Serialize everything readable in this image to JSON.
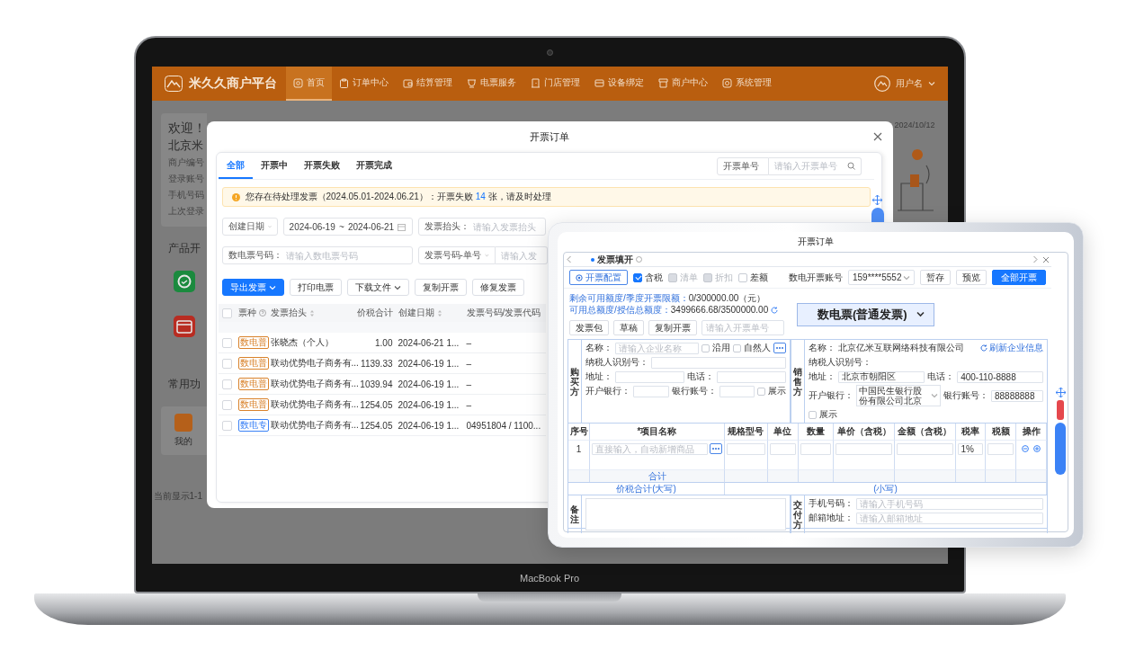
{
  "laptop": {
    "model": "MacBook Pro"
  },
  "nav": {
    "brand": "米久久商户平台",
    "items": [
      {
        "label": "首页",
        "selected": true
      },
      {
        "label": "订单中心",
        "selected": false
      },
      {
        "label": "结算管理",
        "selected": false
      },
      {
        "label": "电票服务",
        "selected": false
      },
      {
        "label": "门店管理",
        "selected": false
      },
      {
        "label": "设备绑定",
        "selected": false
      },
      {
        "label": "商户中心",
        "selected": false
      },
      {
        "label": "系统管理",
        "selected": false
      }
    ],
    "user": "用户名"
  },
  "dashboard": {
    "greeting": "欢迎！",
    "company": "北京米",
    "info_labels": [
      "商户编号",
      "登录账号",
      "手机号码",
      "上次登录"
    ],
    "products_heading": "产品开",
    "common_heading": "常用功",
    "shortcut": "我的",
    "footer": "当前显示1-1",
    "date": "2024/10/12"
  },
  "orders_dialog": {
    "title": "开票订单",
    "tabs": [
      {
        "label": "全部",
        "selected": true
      },
      {
        "label": "开票中",
        "selected": false
      },
      {
        "label": "开票失败",
        "selected": false
      },
      {
        "label": "开票完成",
        "selected": false
      }
    ],
    "search": {
      "field": "开票单号",
      "placeholder": "请输入开票单号"
    },
    "alert": {
      "before": "您存在待处理发票（2024.05.01-2024.06.21）：开票失败 ",
      "count": "14",
      "after": " 张，请及时处理"
    },
    "filters": {
      "date_type": "创建日期",
      "date_from": "2024-06-19",
      "separator": "~",
      "date_to": "2024-06-21",
      "title_label": "发票抬头：",
      "title_placeholder": "请输入发票抬头",
      "number_label": "数电票号码：",
      "number_placeholder": "请输入数电票号码",
      "code_type": "发票号码-单号",
      "code_placeholder": "请输入发"
    },
    "buttons": [
      {
        "label": "导出发票",
        "kind": "primary",
        "dropdown": true
      },
      {
        "label": "打印电票",
        "kind": "default",
        "dropdown": false
      },
      {
        "label": "下载文件",
        "kind": "default",
        "dropdown": true
      },
      {
        "label": "复制开票",
        "kind": "default",
        "dropdown": false
      },
      {
        "label": "修复发票",
        "kind": "default",
        "dropdown": false
      }
    ],
    "header_checked": false,
    "columns": [
      {
        "label": "票种",
        "help": true,
        "sortable": false,
        "kind": "text"
      },
      {
        "label": "发票抬头",
        "help": false,
        "sortable": true,
        "kind": "text"
      },
      {
        "label": "价税合计",
        "help": false,
        "sortable": false,
        "kind": "number"
      },
      {
        "label": "创建日期",
        "help": false,
        "sortable": true,
        "kind": "text"
      },
      {
        "label": "发票号码/发票代码",
        "help": false,
        "sortable": false,
        "kind": "text"
      }
    ],
    "rows": [
      {
        "checked": false,
        "type": "数电普",
        "color": "#d9822b",
        "title": "张晓杰（个人）",
        "amount": "1.00",
        "created": "2024-06-21 1...",
        "number": "–"
      },
      {
        "checked": false,
        "type": "数电普",
        "color": "#d9822b",
        "title": "联动优势电子商务有...",
        "amount": "1139.33",
        "created": "2024-06-19 1...",
        "number": "–"
      },
      {
        "checked": false,
        "type": "数电普",
        "color": "#d9822b",
        "title": "联动优势电子商务有...",
        "amount": "1039.94",
        "created": "2024-06-19 1...",
        "number": "–"
      },
      {
        "checked": false,
        "type": "数电普",
        "color": "#d9822b",
        "title": "联动优势电子商务有...",
        "amount": "1254.05",
        "created": "2024-06-19 1...",
        "number": "–"
      },
      {
        "checked": false,
        "type": "数电专",
        "color": "#3b82f6",
        "title": "联动优势电子商务有...",
        "amount": "1254.05",
        "created": "2024-06-19 1...",
        "number": "04951804 / 1100..."
      }
    ]
  },
  "invoice_dialog": {
    "title": "开票订单",
    "tab": "发票填开",
    "config_button": "开票配置",
    "options": [
      {
        "label": "含税",
        "checked": true,
        "disabled": false
      },
      {
        "label": "清单",
        "checked": false,
        "disabled": true
      },
      {
        "label": "折扣",
        "checked": false,
        "disabled": true
      },
      {
        "label": "差额",
        "checked": false,
        "disabled": false
      }
    ],
    "account_label": "数电开票账号",
    "account": "159****5552",
    "actions": [
      {
        "label": "暂存",
        "kind": "default"
      },
      {
        "label": "预览",
        "kind": "default"
      },
      {
        "label": "全部开票",
        "kind": "primary"
      }
    ],
    "quota": [
      {
        "label": "剩余可用额度/季度开票限额：",
        "value": "0/300000.00（元）",
        "refresh": false
      },
      {
        "label": "可用总额度/授信总额度：",
        "value": "3499666.68/3500000.00",
        "refresh": true
      }
    ],
    "quick_buttons": [
      "发票包",
      "草稿",
      "复制开票"
    ],
    "order_placeholder": "请输入开票单号",
    "invoice_type": "数电票(普通发票)",
    "buyer": {
      "heading": "购买方",
      "rows": [
        [
          {
            "kind": "input",
            "label": "名称：",
            "placeholder": "请输入企业名称"
          },
          {
            "kind": "checkbox",
            "label": "沿用",
            "checked": false
          },
          {
            "kind": "checkbox",
            "label": "自然人",
            "checked": false
          },
          {
            "kind": "more"
          }
        ],
        [
          {
            "kind": "input",
            "label": "纳税人识别号："
          }
        ],
        [
          {
            "kind": "input",
            "label": "地址："
          },
          {
            "kind": "input",
            "label": "电话："
          }
        ],
        [
          {
            "kind": "input",
            "label": "开户银行："
          },
          {
            "kind": "input",
            "label": "银行账号："
          },
          {
            "kind": "checkbox",
            "label": "展示",
            "checked": false
          }
        ]
      ]
    },
    "seller": {
      "heading": "销售方",
      "rows": [
        [
          {
            "kind": "text",
            "label": "名称：",
            "value": "北京亿米互联网络科技有限公司"
          },
          {
            "kind": "link",
            "label": "刷新企业信息"
          }
        ],
        [
          {
            "kind": "text",
            "label": "纳税人识别号："
          }
        ],
        [
          {
            "kind": "input",
            "label": "地址：",
            "value": "北京市朝阳区"
          },
          {
            "kind": "input",
            "label": "电话：",
            "value": "400-110-8888"
          }
        ],
        [
          {
            "kind": "select",
            "label": "开户银行：",
            "value": "中国民生银行股份有限公司北京"
          },
          {
            "kind": "input",
            "label": "银行账号：",
            "value": "88888888"
          },
          {
            "kind": "checkbox",
            "label": "展示",
            "checked": false
          }
        ]
      ]
    },
    "items": {
      "columns": [
        "序号",
        "*项目名称",
        "规格型号",
        "单位",
        "数量",
        "单价（含税）",
        "金额（含税）",
        "税率",
        "税额",
        "操作"
      ],
      "rows": [
        {
          "index": "1",
          "name_placeholder": "直接输入，自动新增商品",
          "tax_rate": "1%"
        }
      ],
      "total_label": "合计",
      "amount_words_label": "价税合计(大写)",
      "amount_figures_label": "(小写)"
    },
    "remarks_label": "备注",
    "delivery": {
      "heading": "交付方",
      "fields": [
        {
          "label": "手机号码：",
          "placeholder": "请输入手机号码"
        },
        {
          "label": "邮箱地址：",
          "placeholder": "请输入邮箱地址"
        }
      ]
    }
  }
}
